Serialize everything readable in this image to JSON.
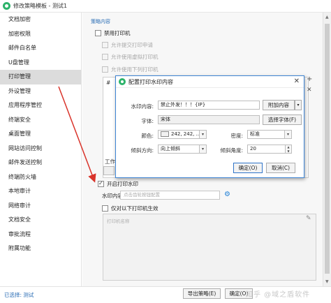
{
  "window": {
    "title": "修改策略模板 - 测试1"
  },
  "sidebar": {
    "items": [
      {
        "label": "文档加密"
      },
      {
        "label": "加密权限"
      },
      {
        "label": "邮件白名单"
      },
      {
        "label": "U盘管理"
      },
      {
        "label": "打印管理",
        "active": true
      },
      {
        "label": "外设管理"
      },
      {
        "label": "应用程序管控"
      },
      {
        "label": "终端安全"
      },
      {
        "label": "桌面管理"
      },
      {
        "label": "网站访问控制"
      },
      {
        "label": "邮件发送控制"
      },
      {
        "label": "终端防火墙"
      },
      {
        "label": "本地审计"
      },
      {
        "label": "网络审计"
      },
      {
        "label": "文档安全"
      },
      {
        "label": "审批流程"
      },
      {
        "label": "附属功能"
      }
    ]
  },
  "policy": {
    "section_title": "策略内容",
    "disable_printer": "禁用打印机",
    "allow_submit_request": "允许提交打印申请",
    "allow_virtual_printer": "允许使用虚拟打印机",
    "allow_listed_printers": "允许使用下列打印机",
    "table_hash_header": "#",
    "work_label": "工作",
    "enable_watermark": "开启打印水印",
    "watermark_content_label": "水印内容:",
    "watermark_content_placeholder": "点击齿轮按钮配置",
    "only_listed_printers": "仅对以下打印机生效",
    "printer_name_placeholder": "打印机名称"
  },
  "dialog": {
    "title": "配置打印水印内容",
    "content_label": "水印内容:",
    "content_value": "禁止外发！！！{IP}",
    "add_content_button": "附加内容",
    "font_label": "字体:",
    "font_value": "宋体",
    "choose_font_button": "选择字体(F)",
    "color_label": "颜色:",
    "color_value": "242, 242, ...",
    "density_label": "密度:",
    "density_value": "标准",
    "direction_label": "倾斜方向:",
    "direction_value": "向上倾斜",
    "angle_label": "倾斜角度:",
    "angle_value": "20",
    "ok_button": "确定(O)",
    "cancel_button": "取消(C)"
  },
  "footer": {
    "selected": "已选择: 测试",
    "export_button": "导出策略(E)",
    "ok_button": "确定(O)",
    "watermark_text": "知乎 @域之盾软件"
  },
  "colors": {
    "accent_blue": "#2a6db5",
    "dialog_border": "#3d84d4",
    "arrow_red": "#d9342b",
    "app_green": "#2db36b"
  }
}
